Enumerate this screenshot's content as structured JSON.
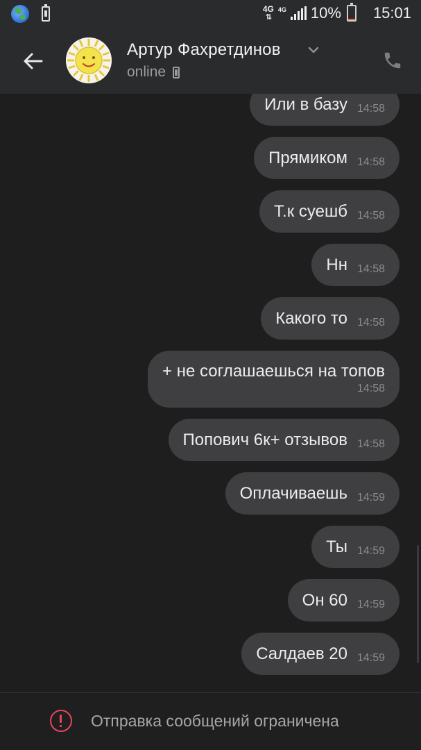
{
  "status_bar": {
    "network": "4G",
    "network2": "4G",
    "battery_percent": "10%",
    "battery_level": 0.1,
    "time": "15:01",
    "icons": [
      "globe-icon",
      "battery-saver-icon",
      "signal-icon",
      "battery-icon"
    ]
  },
  "header": {
    "contact_name": "Артур Фахретдинов",
    "presence": "online",
    "icons": [
      "back-arrow-icon",
      "chevron-down-icon",
      "mobile-device-icon",
      "phone-icon"
    ]
  },
  "messages": [
    {
      "text": "Или в базу",
      "time": "14:58"
    },
    {
      "text": "Прямиком",
      "time": "14:58"
    },
    {
      "text": "Т.к суешб",
      "time": "14:58"
    },
    {
      "text": "Нн",
      "time": "14:58"
    },
    {
      "text": "Какого то",
      "time": "14:58"
    },
    {
      "text": "+ не соглашаешься на топов",
      "time": "14:58",
      "wide": true
    },
    {
      "text": "Попович 6к+ отзывов",
      "time": "14:58"
    },
    {
      "text": "Оплачиваешь",
      "time": "14:59"
    },
    {
      "text": "Ты",
      "time": "14:59"
    },
    {
      "text": "Он 60",
      "time": "14:59"
    },
    {
      "text": "Салдаев 20",
      "time": "14:59"
    }
  ],
  "footer": {
    "restriction_text": "Отправка сообщений ограничена",
    "icon": "alert-circle-icon"
  },
  "colors": {
    "background": "#1e1e1f",
    "header": "#2a2b2d",
    "bubble": "#3f3f41",
    "alert": "#e8455a"
  }
}
